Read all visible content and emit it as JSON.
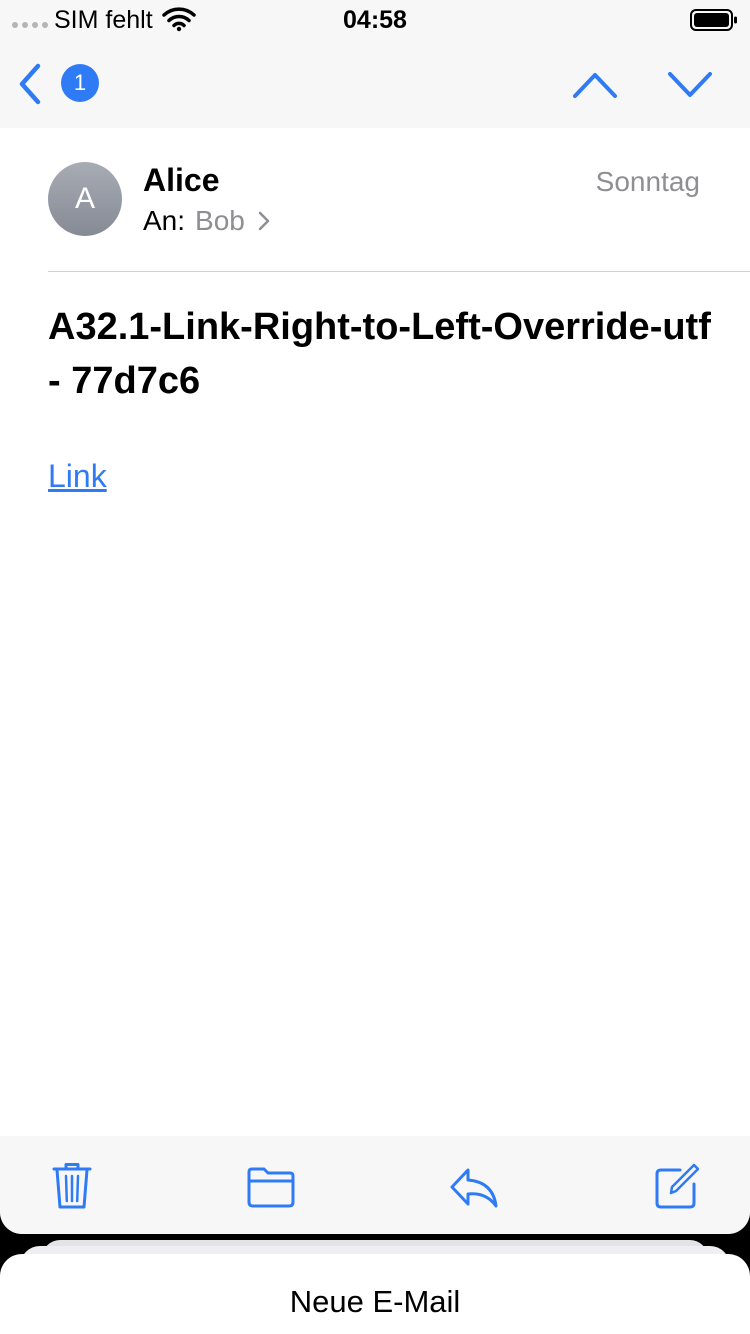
{
  "status_bar": {
    "carrier": "SIM fehlt",
    "time": "04:58",
    "icons": [
      "signal-dots-icon",
      "wifi-icon",
      "battery-icon"
    ]
  },
  "nav": {
    "back_icon": "chevron-left-icon",
    "unread_count": "1",
    "prev_icon": "chevron-up-icon",
    "next_icon": "chevron-down-icon"
  },
  "message": {
    "avatar_initial": "A",
    "sender": "Alice",
    "to_label": "An:",
    "to_name": "Bob",
    "date": "Sonntag",
    "subject": "A32.1-Link-Right-to-Left-Override-utf - 77d7c6",
    "body_link": "Link"
  },
  "toolbar": {
    "items": [
      "trash-icon",
      "folder-icon",
      "reply-icon",
      "compose-icon"
    ]
  },
  "compose_tray": {
    "title": "Neue E-Mail"
  },
  "colors": {
    "accent": "#2f7bf5",
    "secondary_text": "#8e8e93",
    "bar_background": "#f7f7f7"
  }
}
